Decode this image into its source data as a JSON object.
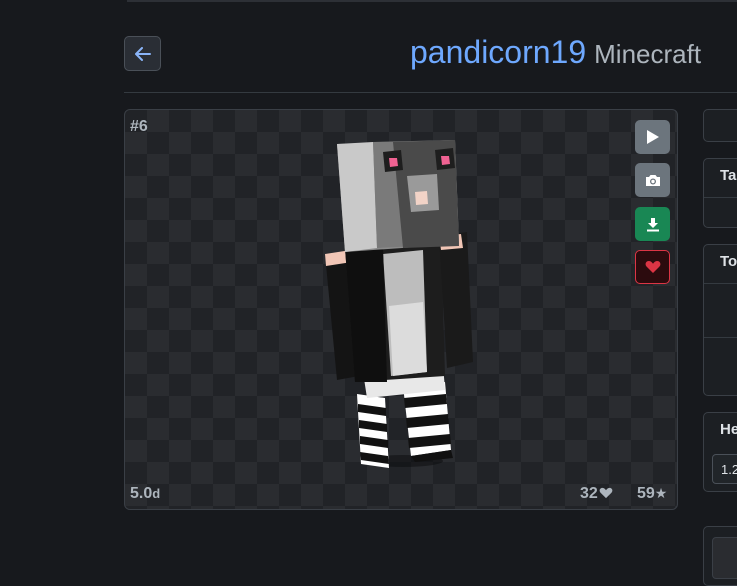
{
  "header": {
    "back_icon": "arrow-left-icon",
    "name": "pandicorn19",
    "subtitle": "Minecraft"
  },
  "viewer": {
    "rank": "#6",
    "age_value": "5.0",
    "age_unit": "d",
    "likes": "32",
    "likes_icon": "heart-icon",
    "stars": "59",
    "stars_icon": "star-icon",
    "tools": [
      "play-icon",
      "camera-icon",
      "download-icon",
      "heart-icon"
    ],
    "colors": {
      "download": "#198754",
      "favorite": "#dc3545"
    }
  },
  "sidebar": {
    "tags_heading": "Ta",
    "top_heading": "To",
    "height_heading": "He",
    "height_value": "1.2"
  }
}
